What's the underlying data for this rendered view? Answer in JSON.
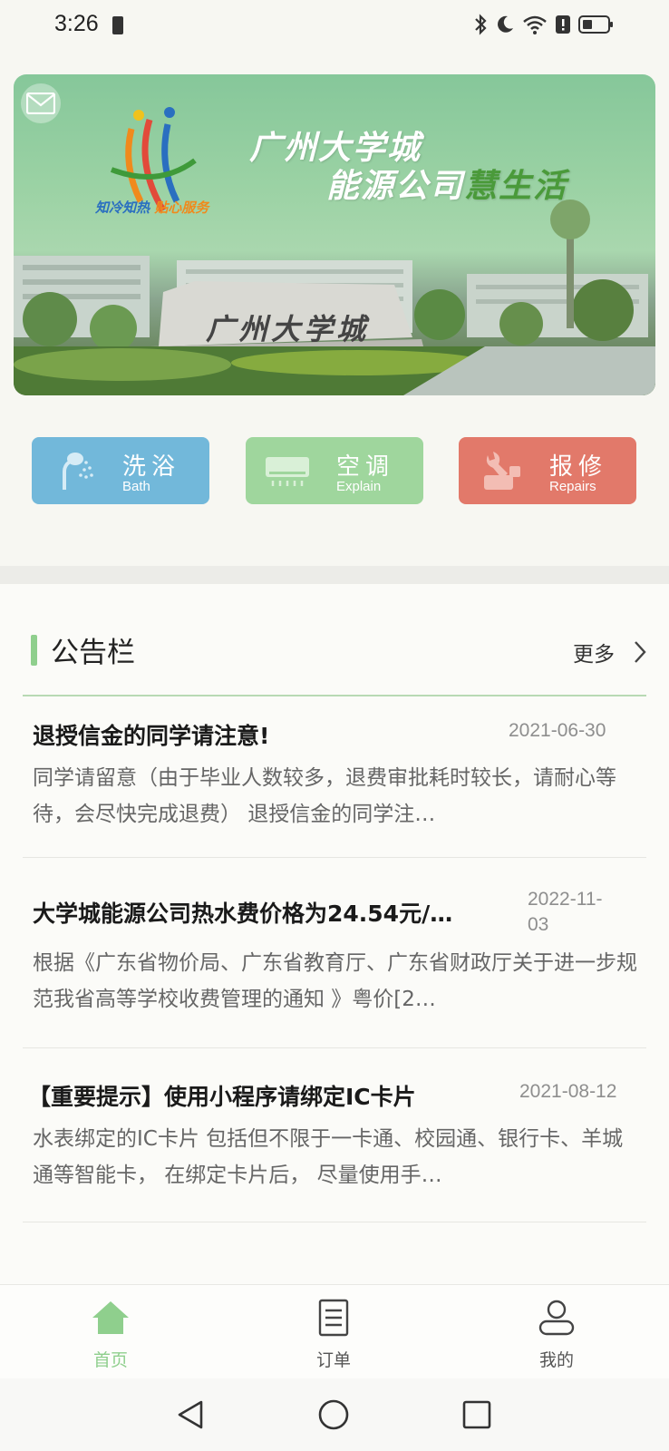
{
  "status_bar": {
    "time": "3:26"
  },
  "banner": {
    "line1": "广州大学城",
    "line2_prefix": "能源公司",
    "line2_accent": "慧生活",
    "slogan_part1": "知冷知热",
    "slogan_part2": "贴心服务",
    "stone_text": "广州大学城"
  },
  "quick_actions": [
    {
      "title": "洗浴",
      "subtitle": "Bath",
      "color": "#72b8da"
    },
    {
      "title": "空调",
      "subtitle": "Explain",
      "color": "#9fd69d"
    },
    {
      "title": "报修",
      "subtitle": "Repairs",
      "color": "#e2796a"
    }
  ],
  "notice_board": {
    "title": "公告栏",
    "more_label": "更多",
    "items": [
      {
        "title": "退授信金的同学请注意!",
        "date": "2021-06-30",
        "body": "同学请留意（由于毕业人数较多，退费审批耗时较长，请耐心等待，会尽快完成退费） 退授信金的同学注…"
      },
      {
        "title": "大学城能源公司热水费价格为24.54元/…",
        "date_line1": "2022-11-",
        "date_line2": "03",
        "body": "根据《广东省物价局、广东省教育厅、广东省财政厅关于进一步规范我省高等学校收费管理的通知 》粤价[2…"
      },
      {
        "title": "【重要提示】使用小程序请绑定IC卡片",
        "date": "2021-08-12",
        "body": "水表绑定的IC卡片 包括但不限于一卡通、校园通、银行卡、羊城通等智能卡， 在绑定卡片后， 尽量使用手…"
      }
    ]
  },
  "tabbar": {
    "tabs": [
      {
        "label": "首页",
        "active": true
      },
      {
        "label": "订单",
        "active": false
      },
      {
        "label": "我的",
        "active": false
      }
    ]
  },
  "colors": {
    "accent_green": "#8fcf8d",
    "bath_blue": "#72b8da",
    "repair_red": "#e2796a"
  }
}
